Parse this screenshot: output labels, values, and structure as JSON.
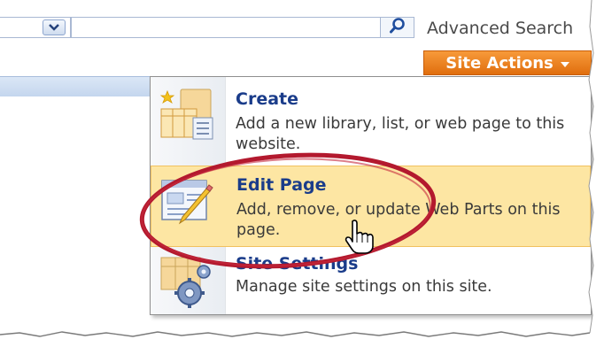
{
  "search": {
    "advanced_search_label": "Advanced Search",
    "query_value": ""
  },
  "site_actions": {
    "label": "Site Actions"
  },
  "menu": {
    "items": [
      {
        "title": "Create",
        "description": "Add a new library, list, or web page to this website.",
        "icon": "create-icon"
      },
      {
        "title": "Edit Page",
        "description": "Add, remove, or update Web Parts on this page.",
        "icon": "edit-page-icon"
      },
      {
        "title": "Site Settings",
        "description": "Manage site settings on this site.",
        "icon": "site-settings-icon"
      }
    ]
  },
  "colors": {
    "accent_orange": "#e87a1e",
    "highlight_yellow": "#fde6a3",
    "annotation_red": "#b3192e",
    "title_blue": "#1a3c8a"
  }
}
